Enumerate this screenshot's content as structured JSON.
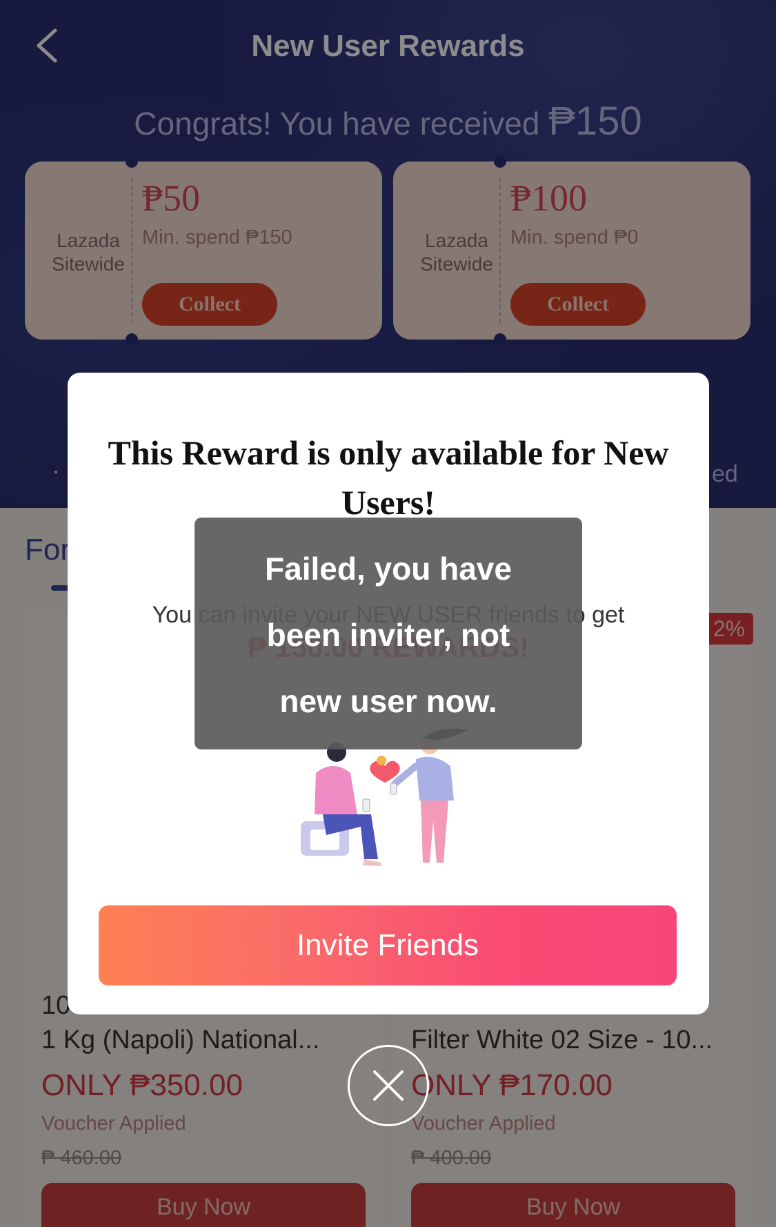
{
  "header": {
    "back_icon": "chevron-left-icon",
    "title": "New User Rewards"
  },
  "congrats": {
    "text": "Congrats! You have received ",
    "amount": "₱150"
  },
  "vouchers": [
    {
      "scope_line1": "Lazada",
      "scope_line2": "Sitewide",
      "value": "₱50",
      "min_spend": "Min. spend ₱150",
      "button": "Collect"
    },
    {
      "scope_line1": "Lazada",
      "scope_line2": "Sitewide",
      "value": "₱100",
      "min_spend": "Min. spend ₱0",
      "button": "Collect"
    }
  ],
  "hero_right_fragment": "ed",
  "tab_fragment": "For",
  "badge_fragment": "2%",
  "products": [
    {
      "name_line1": "10",
      "name_line2": "1 Kg (Napoli) National...",
      "price": "ONLY ₱350.00",
      "voucher": "Voucher Applied",
      "old_price": "₱ 460.00",
      "button": "Buy Now"
    },
    {
      "name_line1": "",
      "name_line2": "Filter White 02 Size - 10...",
      "price": "ONLY ₱170.00",
      "voucher": "Voucher Applied",
      "old_price": "₱ 400.00",
      "button": "Buy Now"
    }
  ],
  "modal": {
    "title": "This Reward is only available for New Users!",
    "text": "You can invite your NEW USER friends to get",
    "reward": "₱ 150.00 REWARDS!",
    "illustration": "friends-sharing-gift-illustration",
    "button": "Invite Friends"
  },
  "toast": {
    "line1": "Failed, you have",
    "line2": "been inviter, not",
    "line3": "new user now."
  },
  "close_icon": "close-icon",
  "colors": {
    "hero_bg": "#2b2f73",
    "accent_red": "#d9293c",
    "button_gradient_start": "#fd8052",
    "button_gradient_end": "#f8467a"
  }
}
